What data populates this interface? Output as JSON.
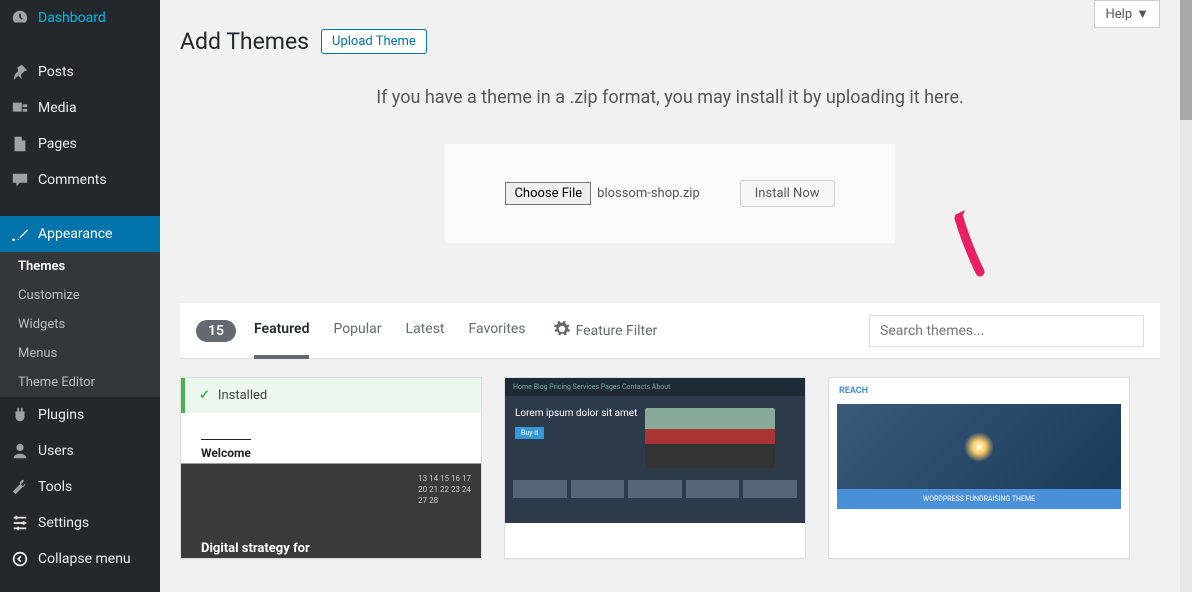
{
  "sidebar": {
    "items": [
      {
        "label": "Dashboard",
        "icon": "dashboard"
      },
      {
        "label": "Posts",
        "icon": "pin"
      },
      {
        "label": "Media",
        "icon": "media"
      },
      {
        "label": "Pages",
        "icon": "page"
      },
      {
        "label": "Comments",
        "icon": "comment"
      },
      {
        "label": "Appearance",
        "icon": "brush",
        "active": true
      },
      {
        "label": "Plugins",
        "icon": "plug"
      },
      {
        "label": "Users",
        "icon": "users"
      },
      {
        "label": "Tools",
        "icon": "wrench"
      },
      {
        "label": "Settings",
        "icon": "sliders"
      },
      {
        "label": "Collapse menu",
        "icon": "collapse"
      }
    ],
    "submenu": [
      {
        "label": "Themes",
        "current": true
      },
      {
        "label": "Customize"
      },
      {
        "label": "Widgets"
      },
      {
        "label": "Menus"
      },
      {
        "label": "Theme Editor"
      }
    ]
  },
  "header": {
    "help_label": "Help",
    "page_title": "Add Themes",
    "upload_button": "Upload Theme"
  },
  "upload": {
    "instruction": "If you have a theme in a .zip format, you may install it by uploading it here.",
    "choose_file_label": "Choose File",
    "filename": "blossom-shop.zip",
    "install_label": "Install Now"
  },
  "filters": {
    "count": "15",
    "tabs": [
      {
        "label": "Featured",
        "active": true
      },
      {
        "label": "Popular"
      },
      {
        "label": "Latest"
      },
      {
        "label": "Favorites"
      }
    ],
    "feature_filter_label": "Feature Filter",
    "search_placeholder": "Search themes..."
  },
  "themes": [
    {
      "installed": true,
      "installed_label": "Installed",
      "welcome": "Welcome",
      "title": "Digital strategy for"
    },
    {
      "nav": "Home  Blog  Pricing  Services  Pages  Contacts  About",
      "hero": "Lorem ipsum dolor sit amet",
      "btn": "Buy it"
    },
    {
      "brand": "REACH",
      "caption": "WORDPRESS FUNDRAISING THEME"
    }
  ]
}
